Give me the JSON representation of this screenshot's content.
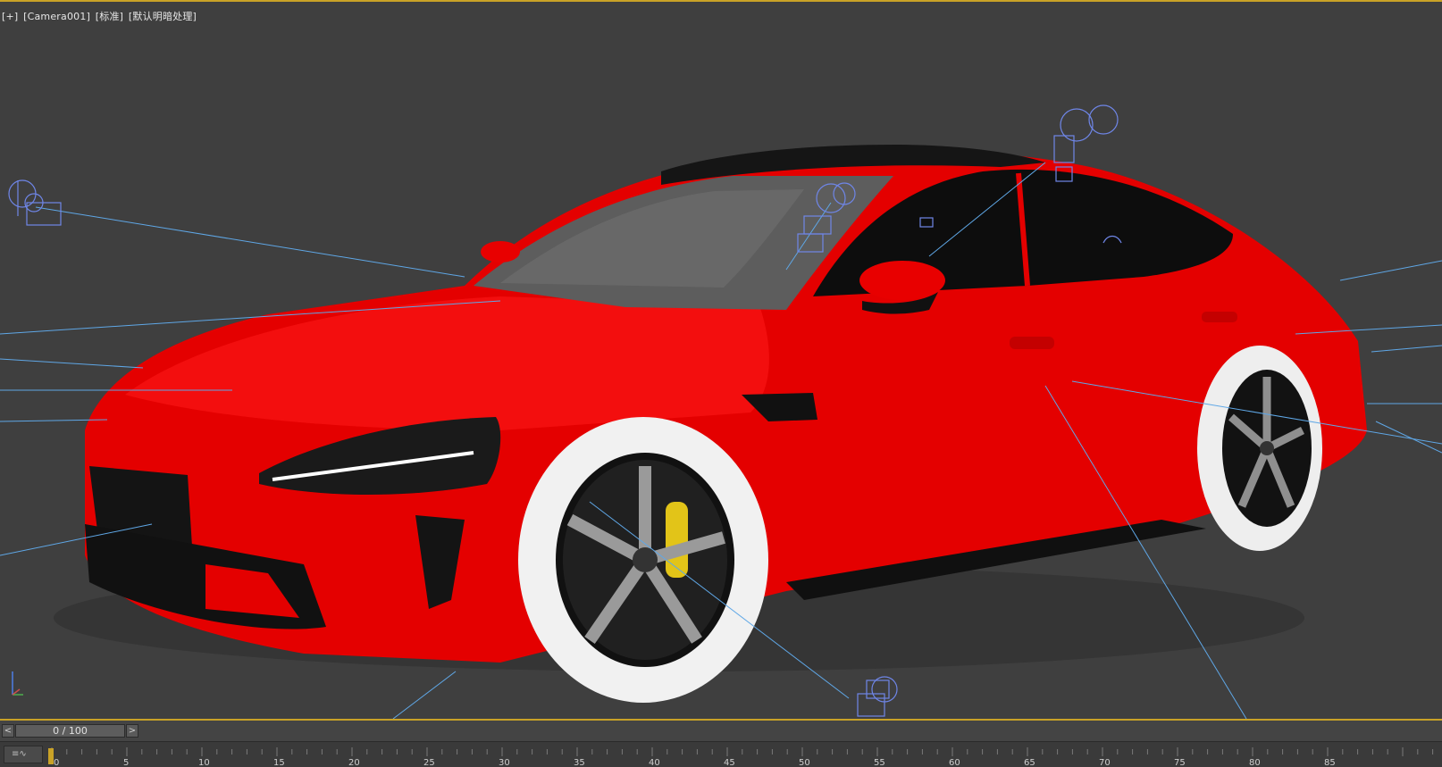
{
  "viewport": {
    "labels": [
      "[+]",
      "[Camera001]",
      "[标准]",
      "[默认明暗处理]"
    ]
  },
  "colors": {
    "viewport_bg": "#3f3f3f",
    "border_active": "#c9a227",
    "car_body": "#e60000",
    "light_gizmo": "#6f86e8",
    "target_line": "#5fa7e6"
  },
  "icons": {
    "prev": "chevron-left-icon",
    "next": "chevron-right-icon",
    "curve": "mini-curve-editor-icon",
    "axis": "axis-tripod-icon"
  },
  "timeline": {
    "prev_label": "<",
    "next_label": ">",
    "current_frame": "0 / 100",
    "tick_labels": [
      "0",
      "5",
      "10",
      "15",
      "20",
      "25",
      "30",
      "35",
      "40",
      "45",
      "50",
      "55",
      "60",
      "65",
      "70",
      "75",
      "80",
      "85"
    ],
    "curve_label": "≡∿"
  }
}
